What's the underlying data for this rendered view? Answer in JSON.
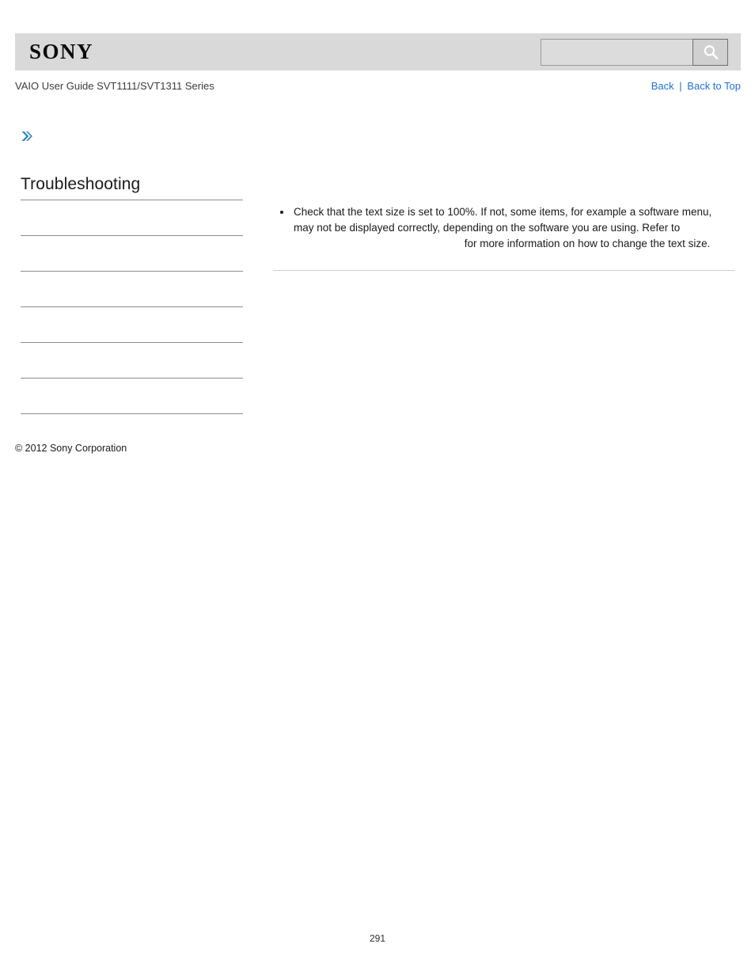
{
  "header": {
    "logo_text": "SONY",
    "logo_color": "#0a0a0a",
    "bar_color": "#d9d9d9",
    "search": {
      "value": "",
      "placeholder": "",
      "button_icon": "search-icon"
    }
  },
  "subheader": {
    "guide_title": "VAIO User Guide SVT1111/SVT1311 Series",
    "links": {
      "back": "Back",
      "separator": "|",
      "back_to_top": "Back to Top",
      "link_color": "#1e73d2"
    }
  },
  "breadcrumb_icon": "chevron-right-icon",
  "sidebar": {
    "title": "Troubleshooting",
    "items": [
      {
        "label": ""
      },
      {
        "label": ""
      },
      {
        "label": ""
      },
      {
        "label": ""
      },
      {
        "label": ""
      },
      {
        "label": ""
      }
    ]
  },
  "main": {
    "bullets": [
      {
        "text_before_link": "Check that the text size is set to 100%. If not, some items, for example a software menu, may not be displayed correctly, depending on the software you are using. Refer to ",
        "link_text": "",
        "text_after_link": " for more information on how to change the text size."
      }
    ]
  },
  "footer": {
    "copyright": "© 2012 Sony Corporation",
    "page_number": "291"
  }
}
